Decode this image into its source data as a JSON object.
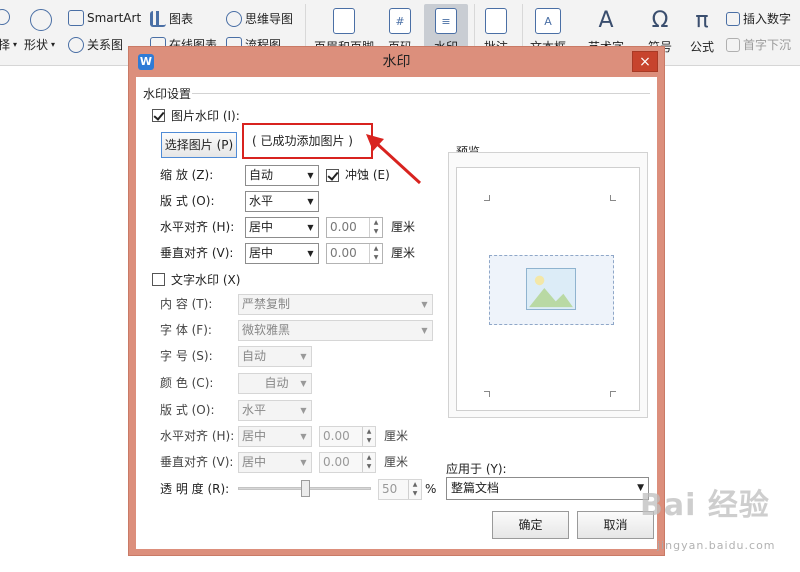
{
  "ribbon": {
    "smartart": "SmartArt",
    "chart": "图表",
    "mindmap": "思维导图",
    "shapes": "形状",
    "relation": "关系图",
    "online_chart": "在线图表",
    "flowchart": "流程图",
    "header_footer": "页眉和页脚",
    "page_number": "页码",
    "watermark": "水印",
    "comment": "批注",
    "textbox": "文本框",
    "wordart": "艺术字",
    "symbol": "符号",
    "formula": "公式",
    "insert_number": "插入数字",
    "dropcap": "首字下沉",
    "partial_left": "择"
  },
  "dialog": {
    "title": "水印",
    "close": "×",
    "app_logo": "W",
    "section_title": "水印设置",
    "picture_watermark": {
      "label": "图片水印 (I):",
      "checked": true,
      "select_button": "选择图片 (P)",
      "status": "( 已成功添加图片 )",
      "scale_label": "缩    放 (Z):",
      "scale_value": "自动",
      "washout_label": "冲蚀 (E)",
      "washout_checked": true,
      "layout_label": "版    式 (O):",
      "layout_value": "水平",
      "halign_label": "水平对齐 (H):",
      "halign_value": "居中",
      "halign_offset": "0.00",
      "valign_label": "垂直对齐 (V):",
      "valign_value": "居中",
      "valign_offset": "0.00",
      "unit": "厘米"
    },
    "text_watermark": {
      "label": "文字水印 (X)",
      "checked": false,
      "content_label": "内    容 (T):",
      "content_value": "严禁复制",
      "font_label": "字    体 (F):",
      "font_value": "微软雅黑",
      "size_label": "字    号 (S):",
      "size_value": "自动",
      "color_label": "颜    色 (C):",
      "color_value": "自动",
      "layout_label": "版    式 (O):",
      "layout_value": "水平",
      "halign_label": "水平对齐 (H):",
      "halign_value": "居中",
      "halign_offset": "0.00",
      "valign_label": "垂直对齐 (V):",
      "valign_value": "居中",
      "valign_offset": "0.00",
      "unit": "厘米",
      "transparency_label": "透 明 度 (R):",
      "transparency_value": "50",
      "transparency_unit": "%"
    },
    "preview_label": "预览",
    "apply_label": "应用于 (Y):",
    "apply_value": "整篇文档",
    "ok": "确定",
    "cancel": "取消"
  },
  "overlay": {
    "logo": "Bai 经验",
    "url": "jingyan.baidu.com"
  },
  "colors": {
    "dialog_frame": "#dc8f7c",
    "close_button": "#c7442d",
    "highlight": "#d8231f",
    "ribbon_bg": "#f3f3f3"
  }
}
